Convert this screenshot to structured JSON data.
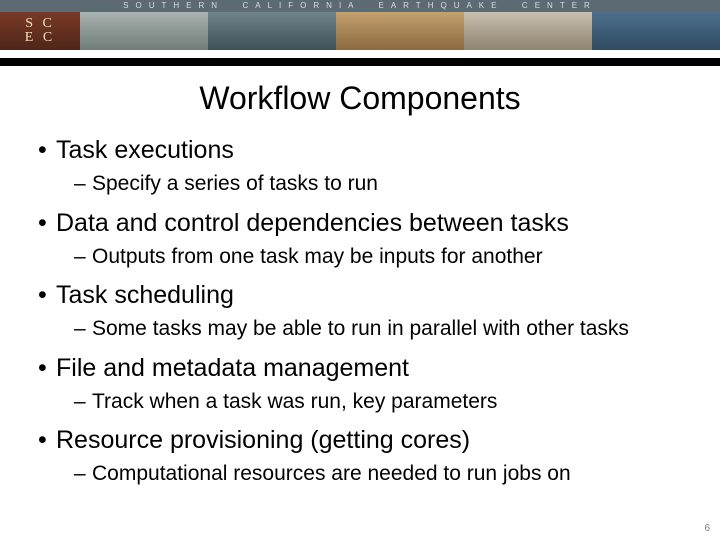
{
  "banner": {
    "org_text": "SOUTHERN  CALIFORNIA  EARTHQUAKE  CENTER",
    "logo_top": "S C",
    "logo_bottom": "E C"
  },
  "title": "Workflow Components",
  "bullets": [
    {
      "text": "Task executions",
      "sub": [
        "Specify a series of tasks to run"
      ]
    },
    {
      "text": "Data and control dependencies between tasks",
      "sub": [
        "Outputs from one task may be inputs for another"
      ]
    },
    {
      "text": "Task scheduling",
      "sub": [
        "Some tasks may be able to run in parallel with other tasks"
      ]
    },
    {
      "text": "File and metadata management",
      "sub": [
        "Track when a task was run, key parameters"
      ]
    },
    {
      "text": "Resource provisioning (getting cores)",
      "sub": [
        "Computational resources are needed to run jobs on"
      ]
    }
  ],
  "page_number": "6"
}
